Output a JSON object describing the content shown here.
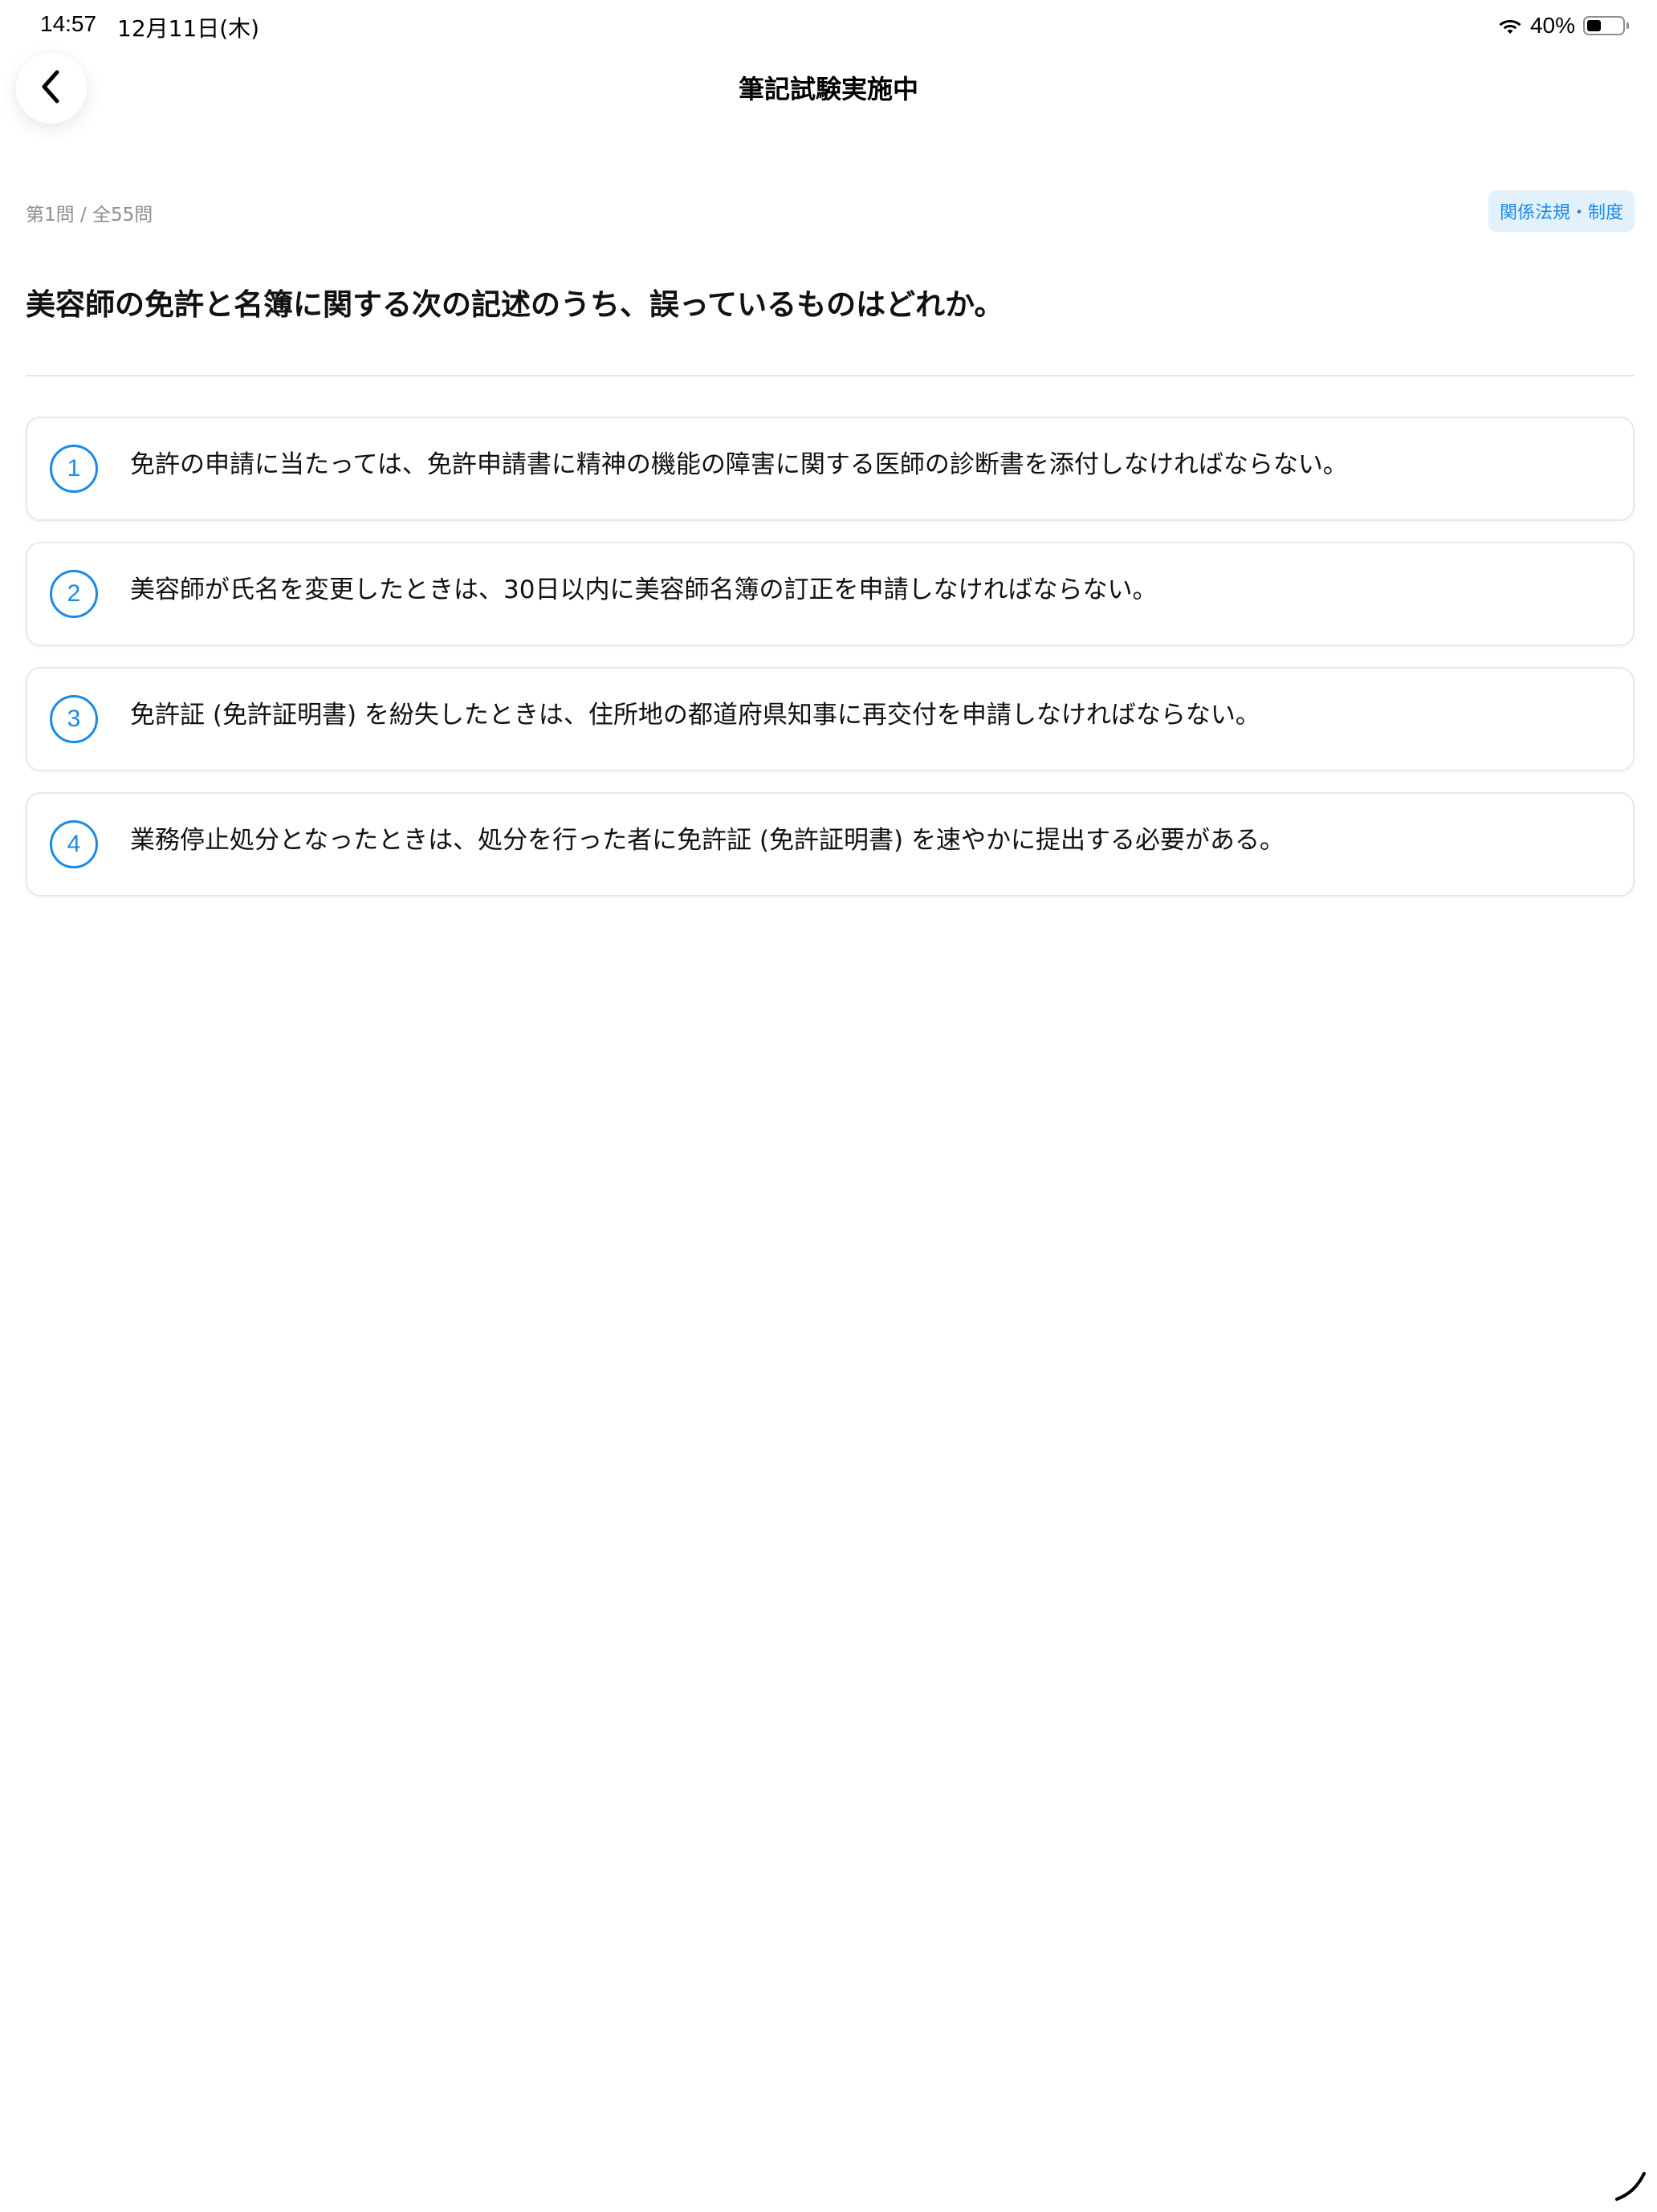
{
  "status_bar": {
    "time": "14:57",
    "date": "12月11日(木)",
    "battery_percent": "40%",
    "battery_level": 0.4,
    "icons": [
      "wifi-icon",
      "battery-icon"
    ]
  },
  "nav": {
    "title": "筆記試験実施中",
    "back_icon": "chevron-left-icon"
  },
  "progress": {
    "text": "第1問 / 全55問",
    "current": 1,
    "total": 55
  },
  "category": {
    "label": "関係法規・制度"
  },
  "question": {
    "text": "美容師の免許と名簿に関する次の記述のうち、誤っているものはどれか。"
  },
  "options": [
    {
      "number": "1",
      "text": "免許の申請に当たっては、免許申請書に精神の機能の障害に関する医師の診断書を添付しなければならない。"
    },
    {
      "number": "2",
      "text": "美容師が氏名を変更したときは、30日以内に美容師名簿の訂正を申請しなければならない。"
    },
    {
      "number": "3",
      "text": "免許証 (免許証明書) を紛失したときは、住所地の都道府県知事に再交付を申請しなければならない。"
    },
    {
      "number": "4",
      "text": "業務停止処分となったときは、処分を行った者に免許証 (免許証明書) を速やかに提出する必要がある。"
    }
  ],
  "colors": {
    "accent": "#1a8ae6",
    "badge_background": "#e3f1fd",
    "muted_text": "#8e8e93",
    "card_border": "#e8e8e8"
  }
}
